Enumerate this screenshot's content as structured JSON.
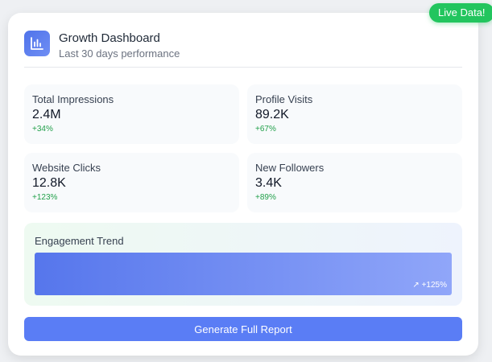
{
  "badge": {
    "label": "Live Data!",
    "color": "#22c55e"
  },
  "header": {
    "icon": "bar-chart-icon",
    "title": "Growth Dashboard",
    "subtitle": "Last 30 days performance"
  },
  "stats": [
    {
      "label": "Total Impressions",
      "value": "2.4M",
      "change": "+34%"
    },
    {
      "label": "Profile Visits",
      "value": "89.2K",
      "change": "+67%"
    },
    {
      "label": "Website Clicks",
      "value": "12.8K",
      "change": "+123%"
    },
    {
      "label": "New Followers",
      "value": "3.4K",
      "change": "+89%"
    }
  ],
  "trend": {
    "title": "Engagement Trend",
    "change": "↗ +125%",
    "fill_percent": 100
  },
  "actions": {
    "report_label": "Generate Full Report"
  },
  "colors": {
    "accent": "#5a7df5",
    "positive": "#22a04b",
    "live": "#22c55e"
  }
}
